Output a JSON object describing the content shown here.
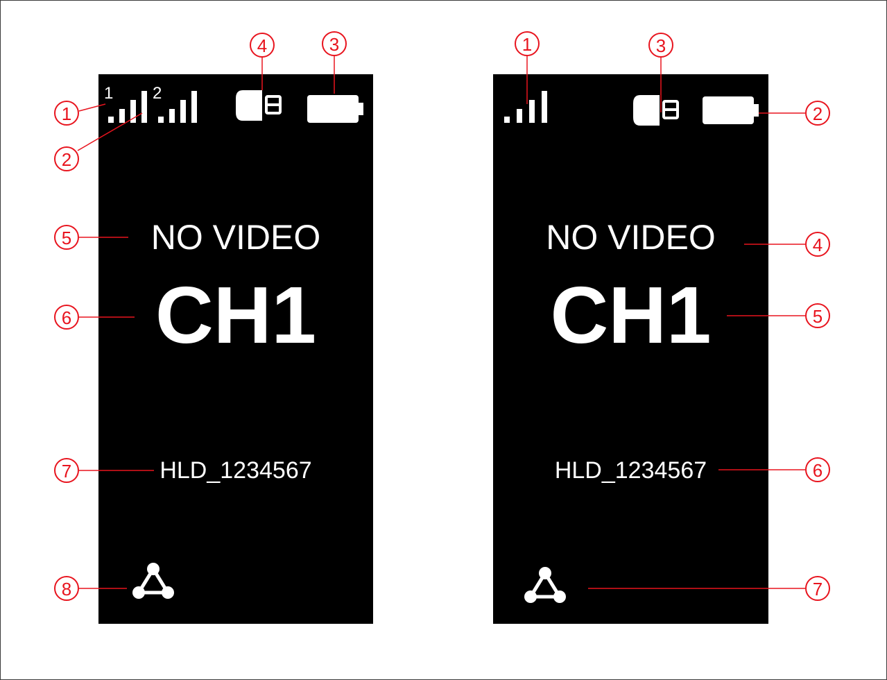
{
  "colors": {
    "screen_bg": "#000000",
    "text": "#ffffff",
    "callout": "#e8141e",
    "frame": "#3a3a3a"
  },
  "left_screen": {
    "signal_1_label": "1",
    "signal_2_label": "2",
    "status_text": "NO VIDEO",
    "channel": "CH1",
    "device_name": "HLD_1234567",
    "icons": [
      "signal-bars-icon",
      "signal-bars-icon",
      "sd-card-icon",
      "battery-icon",
      "network-icon"
    ],
    "callouts": [
      "1",
      "2",
      "3",
      "4",
      "5",
      "6",
      "7",
      "8"
    ]
  },
  "right_screen": {
    "status_text": "NO VIDEO",
    "channel": "CH1",
    "device_name": "HLD_1234567",
    "icons": [
      "signal-bars-icon",
      "sd-card-icon",
      "battery-icon",
      "network-icon"
    ],
    "callouts": [
      "1",
      "2",
      "3",
      "4",
      "5",
      "6",
      "7"
    ]
  }
}
